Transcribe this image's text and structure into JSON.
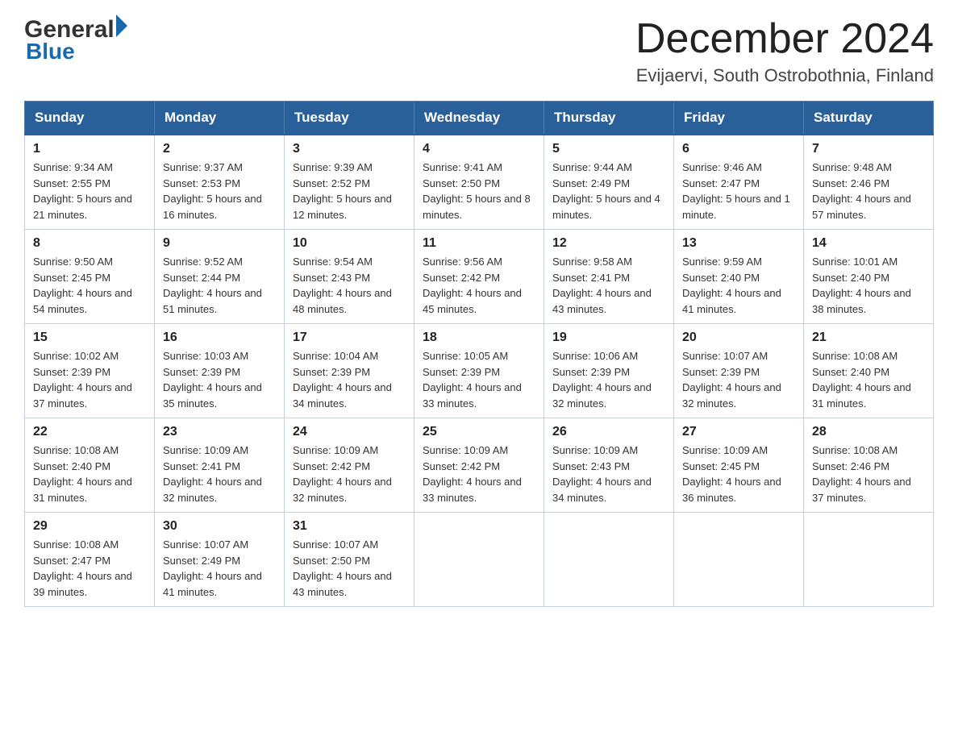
{
  "header": {
    "logo_general": "General",
    "logo_blue": "Blue",
    "title": "December 2024",
    "subtitle": "Evijaervi, South Ostrobothnia, Finland"
  },
  "calendar": {
    "headers": [
      "Sunday",
      "Monday",
      "Tuesday",
      "Wednesday",
      "Thursday",
      "Friday",
      "Saturday"
    ],
    "weeks": [
      [
        {
          "day": "1",
          "sunrise": "9:34 AM",
          "sunset": "2:55 PM",
          "daylight": "5 hours and 21 minutes."
        },
        {
          "day": "2",
          "sunrise": "9:37 AM",
          "sunset": "2:53 PM",
          "daylight": "5 hours and 16 minutes."
        },
        {
          "day": "3",
          "sunrise": "9:39 AM",
          "sunset": "2:52 PM",
          "daylight": "5 hours and 12 minutes."
        },
        {
          "day": "4",
          "sunrise": "9:41 AM",
          "sunset": "2:50 PM",
          "daylight": "5 hours and 8 minutes."
        },
        {
          "day": "5",
          "sunrise": "9:44 AM",
          "sunset": "2:49 PM",
          "daylight": "5 hours and 4 minutes."
        },
        {
          "day": "6",
          "sunrise": "9:46 AM",
          "sunset": "2:47 PM",
          "daylight": "5 hours and 1 minute."
        },
        {
          "day": "7",
          "sunrise": "9:48 AM",
          "sunset": "2:46 PM",
          "daylight": "4 hours and 57 minutes."
        }
      ],
      [
        {
          "day": "8",
          "sunrise": "9:50 AM",
          "sunset": "2:45 PM",
          "daylight": "4 hours and 54 minutes."
        },
        {
          "day": "9",
          "sunrise": "9:52 AM",
          "sunset": "2:44 PM",
          "daylight": "4 hours and 51 minutes."
        },
        {
          "day": "10",
          "sunrise": "9:54 AM",
          "sunset": "2:43 PM",
          "daylight": "4 hours and 48 minutes."
        },
        {
          "day": "11",
          "sunrise": "9:56 AM",
          "sunset": "2:42 PM",
          "daylight": "4 hours and 45 minutes."
        },
        {
          "day": "12",
          "sunrise": "9:58 AM",
          "sunset": "2:41 PM",
          "daylight": "4 hours and 43 minutes."
        },
        {
          "day": "13",
          "sunrise": "9:59 AM",
          "sunset": "2:40 PM",
          "daylight": "4 hours and 41 minutes."
        },
        {
          "day": "14",
          "sunrise": "10:01 AM",
          "sunset": "2:40 PM",
          "daylight": "4 hours and 38 minutes."
        }
      ],
      [
        {
          "day": "15",
          "sunrise": "10:02 AM",
          "sunset": "2:39 PM",
          "daylight": "4 hours and 37 minutes."
        },
        {
          "day": "16",
          "sunrise": "10:03 AM",
          "sunset": "2:39 PM",
          "daylight": "4 hours and 35 minutes."
        },
        {
          "day": "17",
          "sunrise": "10:04 AM",
          "sunset": "2:39 PM",
          "daylight": "4 hours and 34 minutes."
        },
        {
          "day": "18",
          "sunrise": "10:05 AM",
          "sunset": "2:39 PM",
          "daylight": "4 hours and 33 minutes."
        },
        {
          "day": "19",
          "sunrise": "10:06 AM",
          "sunset": "2:39 PM",
          "daylight": "4 hours and 32 minutes."
        },
        {
          "day": "20",
          "sunrise": "10:07 AM",
          "sunset": "2:39 PM",
          "daylight": "4 hours and 32 minutes."
        },
        {
          "day": "21",
          "sunrise": "10:08 AM",
          "sunset": "2:40 PM",
          "daylight": "4 hours and 31 minutes."
        }
      ],
      [
        {
          "day": "22",
          "sunrise": "10:08 AM",
          "sunset": "2:40 PM",
          "daylight": "4 hours and 31 minutes."
        },
        {
          "day": "23",
          "sunrise": "10:09 AM",
          "sunset": "2:41 PM",
          "daylight": "4 hours and 32 minutes."
        },
        {
          "day": "24",
          "sunrise": "10:09 AM",
          "sunset": "2:42 PM",
          "daylight": "4 hours and 32 minutes."
        },
        {
          "day": "25",
          "sunrise": "10:09 AM",
          "sunset": "2:42 PM",
          "daylight": "4 hours and 33 minutes."
        },
        {
          "day": "26",
          "sunrise": "10:09 AM",
          "sunset": "2:43 PM",
          "daylight": "4 hours and 34 minutes."
        },
        {
          "day": "27",
          "sunrise": "10:09 AM",
          "sunset": "2:45 PM",
          "daylight": "4 hours and 36 minutes."
        },
        {
          "day": "28",
          "sunrise": "10:08 AM",
          "sunset": "2:46 PM",
          "daylight": "4 hours and 37 minutes."
        }
      ],
      [
        {
          "day": "29",
          "sunrise": "10:08 AM",
          "sunset": "2:47 PM",
          "daylight": "4 hours and 39 minutes."
        },
        {
          "day": "30",
          "sunrise": "10:07 AM",
          "sunset": "2:49 PM",
          "daylight": "4 hours and 41 minutes."
        },
        {
          "day": "31",
          "sunrise": "10:07 AM",
          "sunset": "2:50 PM",
          "daylight": "4 hours and 43 minutes."
        },
        null,
        null,
        null,
        null
      ]
    ]
  }
}
